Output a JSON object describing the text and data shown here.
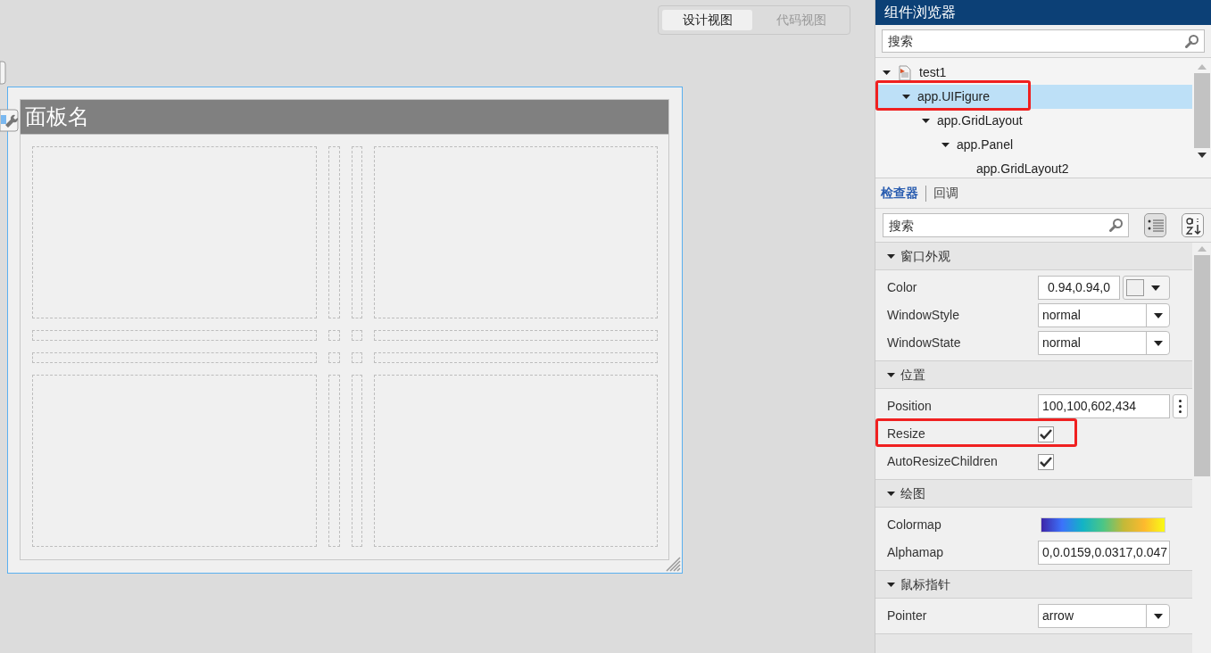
{
  "view_tabs": [
    {
      "label": "设计视图",
      "selected": true
    },
    {
      "label": "代码视图",
      "selected": false
    }
  ],
  "figure": {
    "panel_title": "面板名"
  },
  "component_browser": {
    "title": "组件浏览器",
    "search": {
      "placeholder": "搜索"
    },
    "tree": [
      {
        "label": "test1",
        "expanded": true,
        "selected": false,
        "highlighted": false,
        "children": [
          {
            "label": "app.UIFigure",
            "expanded": true,
            "selected": true,
            "highlighted": true,
            "children": [
              {
                "label": "app.GridLayout",
                "expanded": true,
                "selected": false,
                "highlighted": false,
                "children": [
                  {
                    "label": "app.Panel",
                    "expanded": true,
                    "selected": false,
                    "highlighted": false,
                    "children": [
                      {
                        "label": "app.GridLayout2",
                        "selected": false,
                        "highlighted": false
                      }
                    ]
                  }
                ]
              }
            ]
          }
        ]
      }
    ]
  },
  "inspector_tabs": [
    {
      "label": "检查器",
      "selected": true
    },
    {
      "label": "回调",
      "selected": false
    }
  ],
  "inspector_search": {
    "placeholder": "搜索"
  },
  "sections": [
    {
      "title": "窗口外观",
      "expanded": true,
      "properties": [
        {
          "kind": "color",
          "name": "Color",
          "value": "0.94,0.94,0",
          "highlighted": false
        },
        {
          "kind": "dropdown",
          "name": "WindowStyle",
          "value": "normal",
          "highlighted": false
        },
        {
          "kind": "dropdown",
          "name": "WindowState",
          "value": "normal",
          "highlighted": false
        }
      ]
    },
    {
      "title": "位置",
      "expanded": true,
      "properties": [
        {
          "kind": "vector",
          "name": "Position",
          "value": "100,100,602,434",
          "highlighted": false
        },
        {
          "kind": "checkbox",
          "name": "Resize",
          "checked": true,
          "highlighted": true
        },
        {
          "kind": "checkbox",
          "name": "AutoResizeChildren",
          "checked": true,
          "highlighted": false
        }
      ]
    },
    {
      "title": "绘图",
      "expanded": true,
      "properties": [
        {
          "kind": "colormap",
          "name": "Colormap",
          "highlighted": false
        },
        {
          "kind": "text",
          "name": "Alphamap",
          "value": "0,0.0159,0.0317,0.047",
          "highlighted": false
        }
      ]
    },
    {
      "title": "鼠标指针",
      "expanded": true,
      "properties": [
        {
          "kind": "dropdown",
          "name": "Pointer",
          "value": "arrow",
          "highlighted": false
        }
      ]
    }
  ]
}
